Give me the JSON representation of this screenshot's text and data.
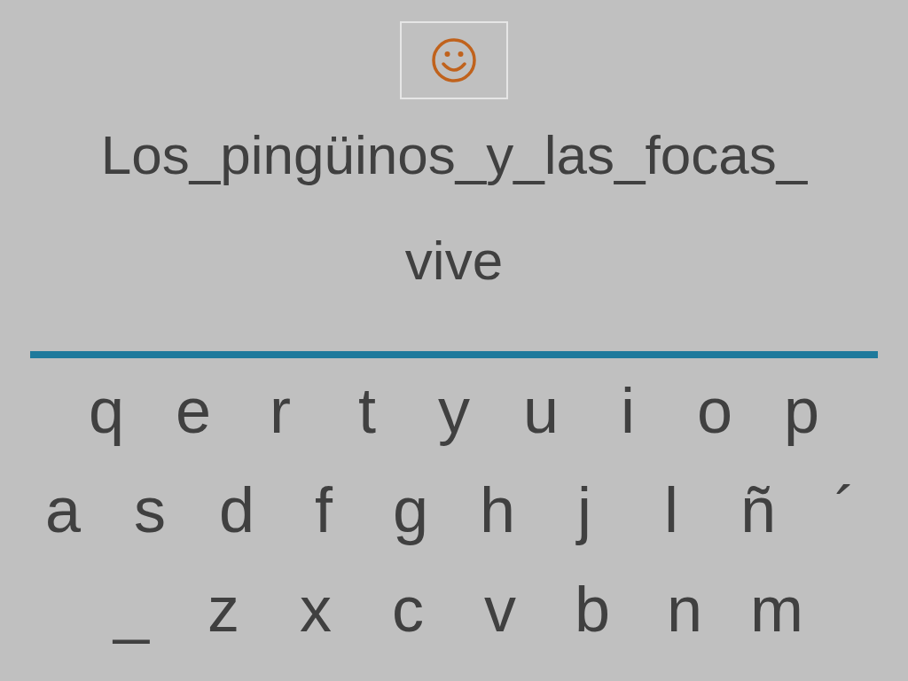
{
  "text_lines": [
    "Los_pingüinos_y_las_focas_",
    "vive"
  ],
  "keyboard": {
    "rows": [
      [
        "q",
        "e",
        "r",
        "t",
        "y",
        "u",
        "i",
        "o",
        "p"
      ],
      [
        "a",
        "s",
        "d",
        "f",
        "g",
        "h",
        "j",
        "l",
        "ñ",
        "´"
      ],
      [
        "_",
        "z",
        "x",
        "c",
        "v",
        "b",
        "n",
        "m"
      ]
    ]
  }
}
